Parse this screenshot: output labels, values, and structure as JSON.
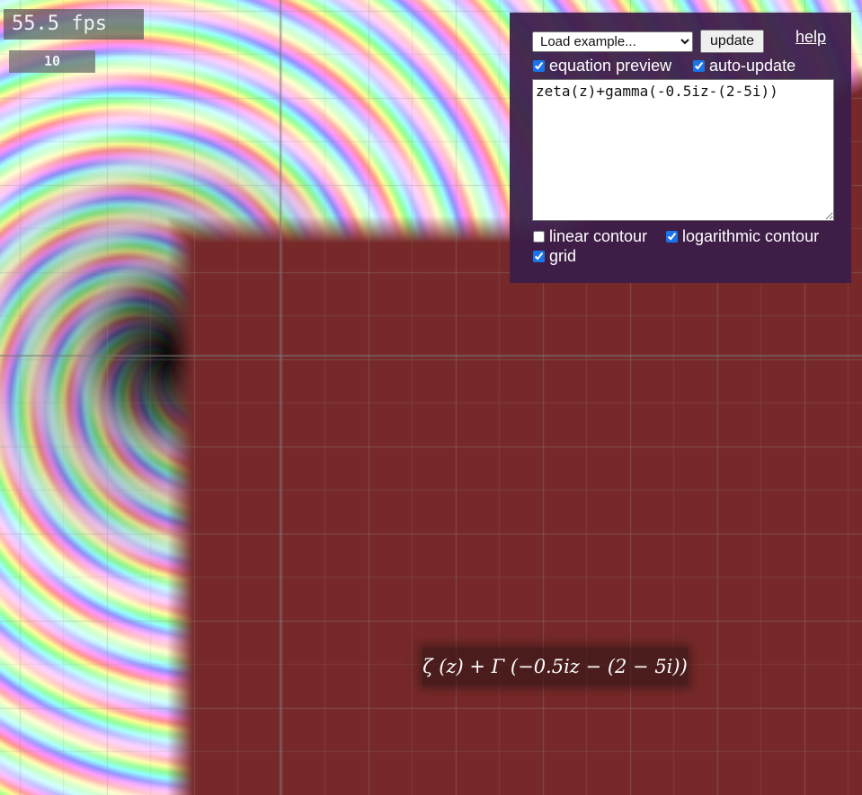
{
  "stats": {
    "fps": "55.5 fps",
    "ms": "10"
  },
  "controls": {
    "example_select_value": "Load example...",
    "update_label": "update",
    "help_label": "help",
    "equation_preview_label": "equation preview",
    "equation_preview_checked": true,
    "auto_update_label": "auto-update",
    "auto_update_checked": true,
    "equation": "zeta(z)+gamma(-0.5iz-(2-5i))",
    "linear_contour_label": "linear contour",
    "linear_contour_checked": false,
    "log_contour_label": "logarithmic contour",
    "log_contour_checked": true,
    "grid_label": "grid",
    "grid_checked": true
  },
  "preview": {
    "formula": "ζ (z) + Γ (−0.5iz − (2 − 5i))"
  },
  "colors": {
    "background": "#772929",
    "panel": "#3a1c48"
  }
}
